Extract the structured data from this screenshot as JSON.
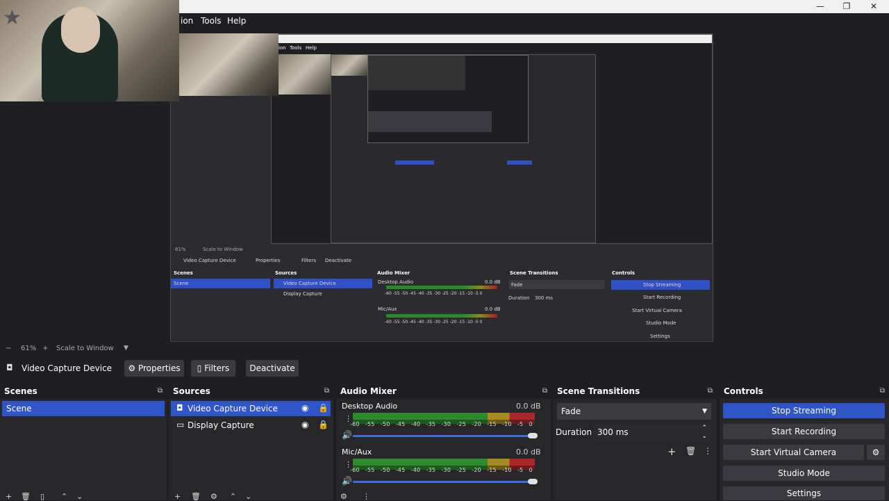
{
  "window": {
    "minimize": "—",
    "maximize": "❐",
    "close": "✕"
  },
  "menu": {
    "items": [
      {
        "label": "ion"
      },
      {
        "label": "Tools"
      },
      {
        "label": "Help"
      }
    ]
  },
  "nested_preview": {
    "menu_tools": "Tools",
    "menu_help": "Help",
    "menu_frag": "ion",
    "source_label": "Video Capture Device",
    "properties": "Properties",
    "filters": "Filters",
    "deactivate": "Deactivate",
    "scenes_title": "Scenes",
    "sources_title": "Sources",
    "mixer_title": "Audio Mixer",
    "transitions_title": "Scene Transitions",
    "controls_title": "Controls",
    "scene_item": "Scene",
    "source_item_1": "Video Capture Device",
    "source_item_2": "Display Capture",
    "desktop_audio": "Desktop Audio",
    "mic_aux": "Mic/Aux",
    "db": "0.0 dB",
    "ticks": "-60  -55  -50  -45  -40  -35  -30  -25  -20  -15  -10   -5    0",
    "fade": "Fade",
    "duration_label": "Duration",
    "duration_value": "300 ms",
    "stop_streaming": "Stop Streaming",
    "start_recording": "Start Recording",
    "start_virtual_camera": "Start Virtual Camera",
    "studio_mode": "Studio Mode",
    "settings": "Settings",
    "zoom": "61%",
    "scale": "Scale to Window"
  },
  "zoom_bar": {
    "minus": "−",
    "percent": "61%",
    "plus": "+",
    "scale": "Scale to Window",
    "caret": "▼"
  },
  "source_toolbar": {
    "source_name": "Video Capture Device",
    "properties": "Properties",
    "filters": "Filters",
    "deactivate": "Deactivate"
  },
  "scenes": {
    "title": "Scenes",
    "items": [
      {
        "label": "Scene"
      }
    ]
  },
  "sources": {
    "title": "Sources",
    "items": [
      {
        "label": "Video Capture Device"
      },
      {
        "label": "Display Capture"
      }
    ]
  },
  "mixer": {
    "title": "Audio Mixer",
    "channels": [
      {
        "name": "Desktop Audio",
        "db": "0.0 dB",
        "level": 1.0
      },
      {
        "name": "Mic/Aux",
        "db": "0.0 dB",
        "level": 1.0
      }
    ],
    "ticks": [
      "-60",
      "-55",
      "-50",
      "-45",
      "-40",
      "-35",
      "-30",
      "-25",
      "-20",
      "-15",
      "-10",
      "-5",
      "0"
    ]
  },
  "transitions": {
    "title": "Scene Transitions",
    "selected": "Fade",
    "duration_label": "Duration",
    "duration_value": "300 ms"
  },
  "controls": {
    "title": "Controls",
    "stop_streaming": "Stop Streaming",
    "start_recording": "Start Recording",
    "start_virtual_camera": "Start Virtual Camera",
    "studio_mode": "Studio Mode",
    "settings": "Settings"
  },
  "colors": {
    "accent": "#2f55c8",
    "panel": "#272729",
    "background": "#1f1f23"
  }
}
